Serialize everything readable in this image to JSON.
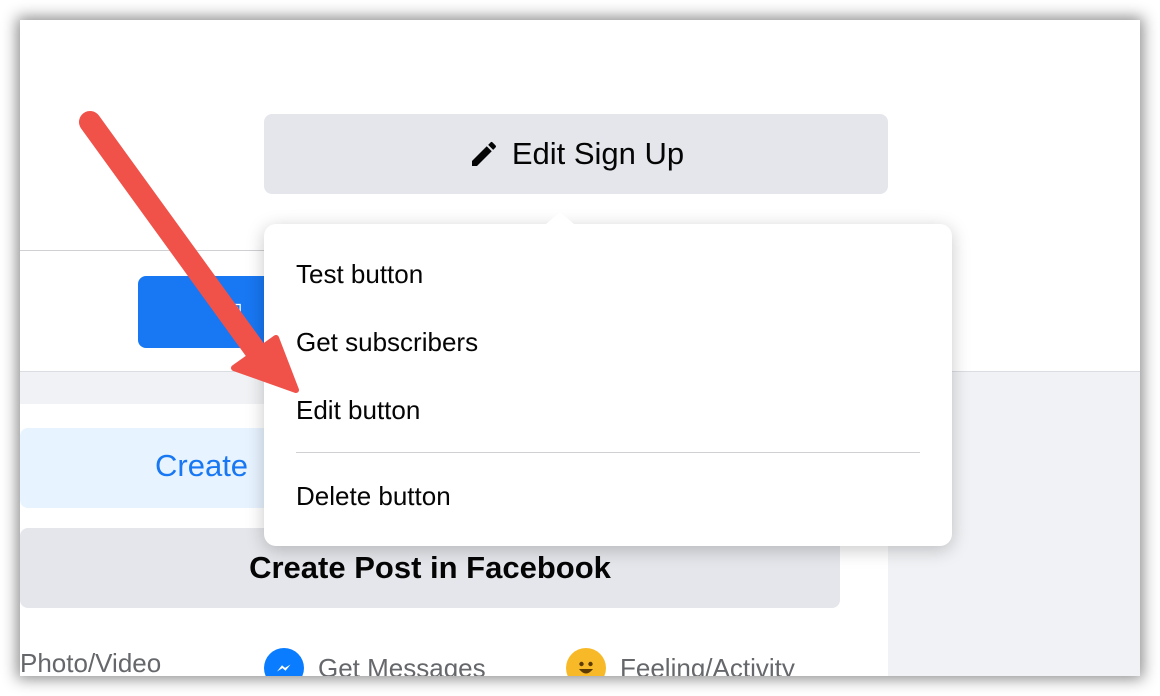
{
  "header": {
    "edit_signup_label": "Edit Sign Up",
    "edit_icon": "pencil-icon"
  },
  "menu": {
    "items": [
      {
        "label": "Test button"
      },
      {
        "label": "Get subscribers"
      },
      {
        "label": "Edit button"
      },
      {
        "label": "Delete button"
      }
    ]
  },
  "card": {
    "create_label": "Create",
    "post_button_label": "Create Post in Facebook",
    "actions": [
      {
        "label": "Photo/Video"
      },
      {
        "label": "Get Messages",
        "icon": "messenger-icon"
      },
      {
        "label": "Feeling/Activity",
        "icon": "smiley-icon"
      }
    ]
  },
  "annotation": {
    "arrow_color": "#f0524a",
    "arrow_icon": "arrow-annotation-icon"
  },
  "colors": {
    "accent": "#1877f2",
    "button_gray": "#e4e6eb",
    "page_gray": "#f0f2f5",
    "create_bar_bg": "#e7f3ff"
  }
}
